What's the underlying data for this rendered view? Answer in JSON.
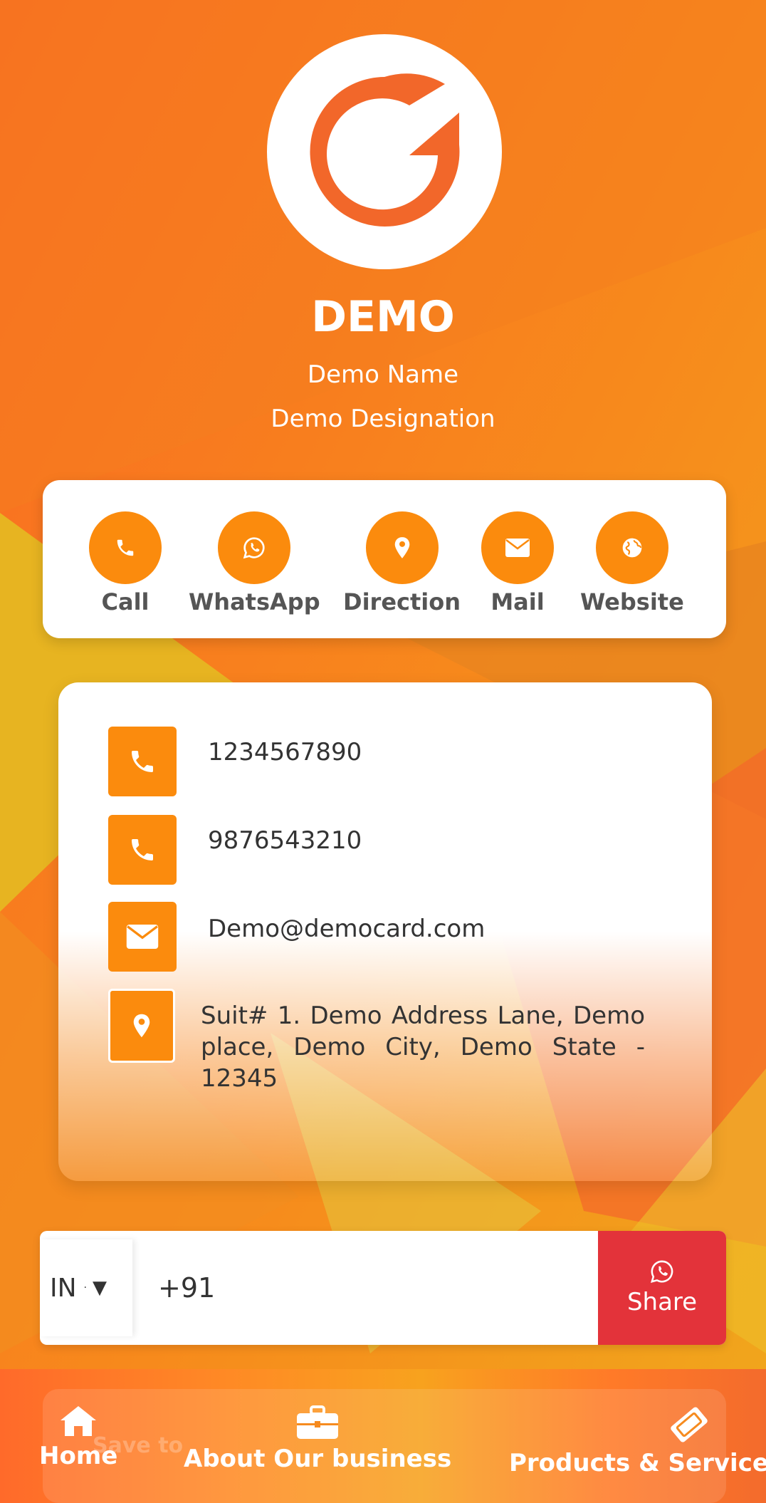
{
  "header": {
    "company": "DEMO",
    "person_name": "Demo Name",
    "designation": "Demo Designation",
    "logo_icon": "g-logo-icon"
  },
  "actions": [
    {
      "label": "Call",
      "icon": "phone-icon"
    },
    {
      "label": "WhatsApp",
      "icon": "whatsapp-icon"
    },
    {
      "label": "Direction",
      "icon": "map-pin-icon"
    },
    {
      "label": "Mail",
      "icon": "envelope-icon"
    },
    {
      "label": "Website",
      "icon": "globe-icon"
    }
  ],
  "contact": {
    "phone_1": "1234567890",
    "phone_2": "9876543210",
    "email": "Demo@democard.com",
    "address": "Suit# 1. Demo Address Lane, Demo place, Demo City, Demo State - 12345"
  },
  "share": {
    "country_code": "IN",
    "dial_prefix": "+91",
    "button_label": "Share"
  },
  "bottom_nav": {
    "save_label": "Save to",
    "items": [
      {
        "label": "Home",
        "icon": "home-icon"
      },
      {
        "label": "About Our business",
        "icon": "briefcase-icon"
      },
      {
        "label": "Products & Services",
        "icon": "ticket-icon"
      }
    ]
  },
  "colors": {
    "accent": "#fb8b0d",
    "share_button": "#e3333a",
    "logo_orange": "#f2672a"
  }
}
